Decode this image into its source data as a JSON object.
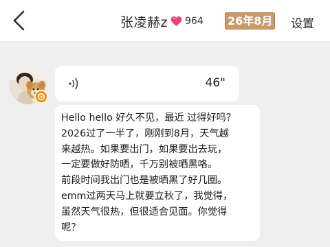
{
  "header": {
    "contact_name": "张凌赫z",
    "heart_count": "964",
    "month_badge": "26年8月",
    "settings_label": "设置",
    "heart_color": "#e8457a"
  },
  "messages": [
    {
      "type": "voice",
      "duration": "46\""
    },
    {
      "type": "text",
      "lines": [
        "Hello hello 好久不见，最近 过得好吗？",
        "2026过了一半了，刚刚到8月，天气越",
        "来越热。如果要出门，如果要出去玩，",
        "一定要做好防晒，千万别被晒黑咯。",
        "前段时间我出门也是被晒黑了好几圈。",
        "emm过两天马上就要立秋了，我觉得，",
        "虽然天气很热，但很适合见面。你觉得",
        "呢？"
      ]
    }
  ]
}
